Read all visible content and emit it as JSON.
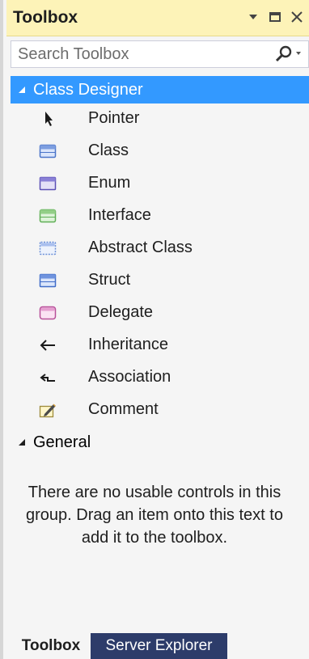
{
  "window": {
    "title": "Toolbox"
  },
  "search": {
    "placeholder": "Search Toolbox"
  },
  "groups": [
    {
      "label": "Class Designer",
      "expanded": true,
      "selected": true,
      "items": [
        {
          "label": "Pointer",
          "icon": "pointer-icon"
        },
        {
          "label": "Class",
          "icon": "class-icon"
        },
        {
          "label": "Enum",
          "icon": "enum-icon"
        },
        {
          "label": "Interface",
          "icon": "interface-icon"
        },
        {
          "label": "Abstract Class",
          "icon": "abstract-class-icon"
        },
        {
          "label": "Struct",
          "icon": "struct-icon"
        },
        {
          "label": "Delegate",
          "icon": "delegate-icon"
        },
        {
          "label": "Inheritance",
          "icon": "inheritance-icon"
        },
        {
          "label": "Association",
          "icon": "association-icon"
        },
        {
          "label": "Comment",
          "icon": "comment-icon"
        }
      ]
    },
    {
      "label": "General",
      "expanded": true,
      "selected": false,
      "empty_message": "There are no usable controls in this group. Drag an item onto this text to add it to the toolbox."
    }
  ],
  "tabs": [
    {
      "label": "Toolbox",
      "active": true
    },
    {
      "label": "Server Explorer",
      "active": false
    }
  ],
  "colors": {
    "title_bar": "#fdf3b8",
    "selection": "#3399ff",
    "inactive_tab": "#2d3c6a"
  }
}
